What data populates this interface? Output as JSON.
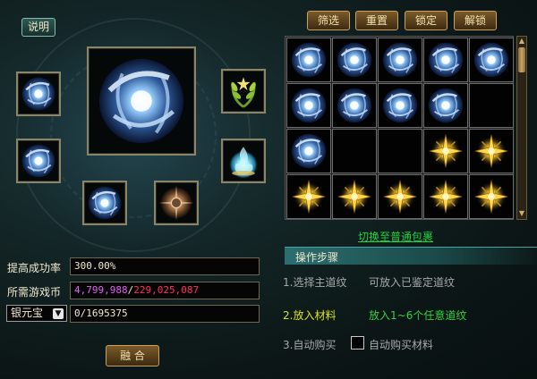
{
  "top_buttons": [
    "筛选",
    "重置",
    "锁定",
    "解锁"
  ],
  "help_button": "说明",
  "fuse_button": "融 合",
  "switch_link": "切换至普通包裹",
  "steps": {
    "header": "操作步骤",
    "items": [
      {
        "num": "1.选择主道纹",
        "desc": "可放入已鉴定道纹",
        "color": "#a8a8a8"
      },
      {
        "num": "2.放入材料",
        "desc": "放入1~6个任意道纹",
        "color": "#d8e020",
        "desc_color": "#30d040"
      },
      {
        "num": "3.自动购买",
        "desc": "自动购买材料",
        "color": "#a8a8a8"
      }
    ]
  },
  "fields": {
    "success_rate_label": "提高成功率",
    "success_rate_value": "300.00%",
    "cost_label": "所需游戏币",
    "cost_have": "4,799,988",
    "cost_sep": "/",
    "cost_need": "229,025,087",
    "currency_label": "银元宝",
    "currency_value": "0/1695375"
  },
  "colors": {
    "gold_text": "#f4e4b0",
    "cost_have": "#e060f0",
    "cost_need": "#ff3060",
    "link_green": "#20d040"
  },
  "inventory": [
    [
      "blue-orb",
      "blue-orb",
      "blue-orb",
      "blue-orb",
      "blue-orb"
    ],
    [
      "blue-orb",
      "blue-orb",
      "blue-orb",
      "blue-orb",
      "empty"
    ],
    [
      "blue-orb",
      "empty",
      "empty",
      "gold-star",
      "gold-star"
    ],
    [
      "gold-star",
      "gold-star",
      "gold-star",
      "gold-star",
      "gold-star"
    ]
  ],
  "fusion_slots": {
    "main": "blue-orb",
    "material": [
      "blue-orb",
      "blue-orb",
      "blue-orb",
      "bronze-orb",
      "green-wreath",
      "teal-flame"
    ]
  }
}
